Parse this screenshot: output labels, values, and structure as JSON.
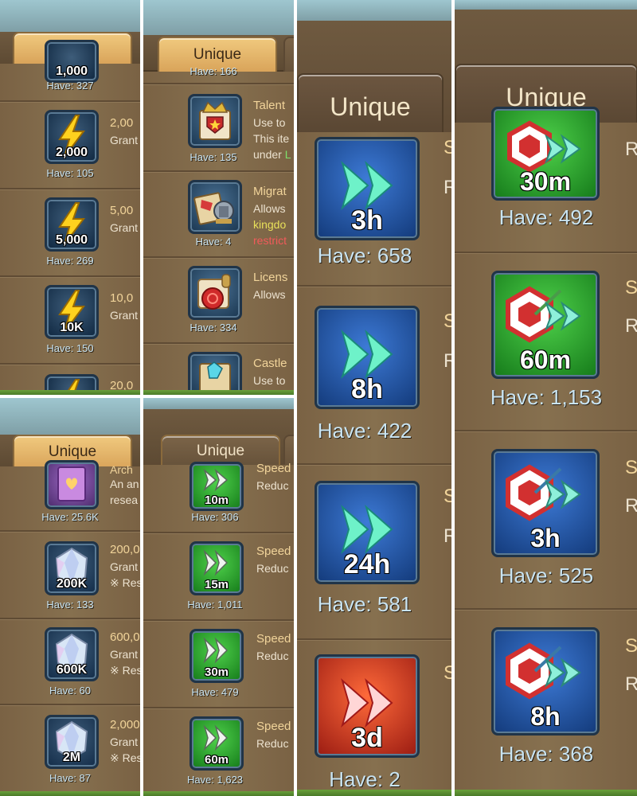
{
  "panel1": {
    "tab": "Unique",
    "top_partial": {
      "label": "1,000",
      "have": "Have: 327"
    },
    "items": [
      {
        "icon": "lightning-icon",
        "label": "2,000",
        "name": "2,00",
        "desc": "Grant",
        "have": "Have: 105"
      },
      {
        "icon": "lightning-icon",
        "label": "5,000",
        "name": "5,00",
        "desc": "Grant",
        "have": "Have: 269"
      },
      {
        "icon": "lightning-icon",
        "label": "10K",
        "name": "10,0",
        "desc": "Grant",
        "have": "Have: 150"
      }
    ],
    "bottom_partial": {
      "name": "20,0"
    }
  },
  "panel2": {
    "tab": "Unique",
    "top_partial": {
      "have": "Have: 166"
    },
    "items": [
      {
        "icon": "talent-book-icon",
        "name": "Talent",
        "desc1": "Use to",
        "desc2": "This ite",
        "desc3a": "under ",
        "desc3b": "L",
        "have": "Have: 135"
      },
      {
        "icon": "migration-scroll-icon",
        "name": "Migrat",
        "desc1": "Allows",
        "desc2": "kingdo",
        "desc3": "restrict",
        "have": "Have: 4"
      },
      {
        "icon": "license-scroll-icon",
        "name": "Licens",
        "desc1": "Allows",
        "have": "Have: 334"
      }
    ],
    "bottom_partial": {
      "icon": "castle-scroll-icon",
      "name": "Castle",
      "desc": "Use to"
    }
  },
  "panel3": {
    "tab": "Unique",
    "items": [
      {
        "icon": "speedup-arrows-icon",
        "label": "3h",
        "have": "Have: 658",
        "name": "S",
        "desc": "R",
        "color": "blue"
      },
      {
        "icon": "speedup-arrows-icon",
        "label": "8h",
        "have": "Have: 422",
        "name": "S",
        "desc": "R",
        "color": "blue"
      },
      {
        "icon": "speedup-arrows-icon",
        "label": "24h",
        "have": "Have: 581",
        "name": "S",
        "desc": "R",
        "color": "blue"
      },
      {
        "icon": "speedup-arrows-icon",
        "label": "3d",
        "have": "Have: 2",
        "name": "S",
        "desc": "",
        "color": "red"
      }
    ]
  },
  "panel4": {
    "tab": "Unique",
    "items": [
      {
        "icon": "target-speedup-icon",
        "label": "30m",
        "have": "Have: 492",
        "name": "",
        "desc": "R",
        "color": "green"
      },
      {
        "icon": "target-speedup-icon",
        "label": "60m",
        "have": "Have: 1,153",
        "name": "S",
        "desc": "R",
        "color": "green"
      },
      {
        "icon": "target-speedup-icon",
        "label": "3h",
        "have": "Have: 525",
        "name": "S",
        "desc": "R",
        "color": "blue"
      },
      {
        "icon": "target-speedup-icon",
        "label": "8h",
        "have": "Have: 368",
        "name": "S",
        "desc": "R",
        "color": "blue"
      }
    ]
  },
  "panel5": {
    "tab": "Unique",
    "top_partial": {
      "icon": "research-book-icon",
      "name": "Arch",
      "desc1": "An an",
      "desc2": "resea",
      "have": "Have: 25.6K"
    },
    "items": [
      {
        "icon": "crystal-icon",
        "label": "200K",
        "name": "200,0",
        "desc1": "Grant",
        "desc2": "※ Res",
        "have": "Have: 133"
      },
      {
        "icon": "crystal-icon",
        "label": "600K",
        "name": "600,0",
        "desc1": "Grant",
        "desc2": "※ Res",
        "have": "Have: 60"
      },
      {
        "icon": "crystal-icon",
        "label": "2M",
        "name": "2,000",
        "desc1": "Grant",
        "desc2": "※ Res",
        "have": "Have: 87"
      }
    ]
  },
  "panel6": {
    "tab": "Unique",
    "items": [
      {
        "icon": "speedup-arrows-icon",
        "label": "10m",
        "name": "Speed",
        "desc": "Reduc",
        "have": "Have: 306"
      },
      {
        "icon": "speedup-arrows-icon",
        "label": "15m",
        "name": "Speed",
        "desc": "Reduc",
        "have": "Have: 1,011"
      },
      {
        "icon": "speedup-arrows-icon",
        "label": "30m",
        "name": "Speed",
        "desc": "Reduc",
        "have": "Have: 479"
      },
      {
        "icon": "speedup-arrows-icon",
        "label": "60m",
        "name": "Speed",
        "desc": "Reduc",
        "have": "Have: 1,623"
      }
    ]
  }
}
